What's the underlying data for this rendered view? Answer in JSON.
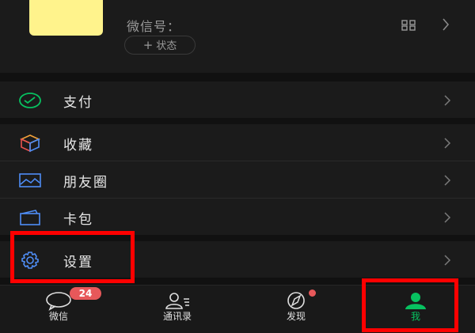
{
  "profile": {
    "wechat_id_label": "微信号：",
    "status_label": "状态",
    "status_plus": "+"
  },
  "menu": {
    "pay": "支付",
    "favorites": "收藏",
    "moments": "朋友圈",
    "cards": "卡包",
    "settings": "设置"
  },
  "tabs": {
    "chats": "微信",
    "contacts": "通讯录",
    "discover": "发现",
    "me": "我",
    "chats_badge": "24"
  },
  "colors": {
    "accent_green": "#07c160",
    "badge_red": "#e7585a",
    "annotation_red": "#ff0000"
  }
}
